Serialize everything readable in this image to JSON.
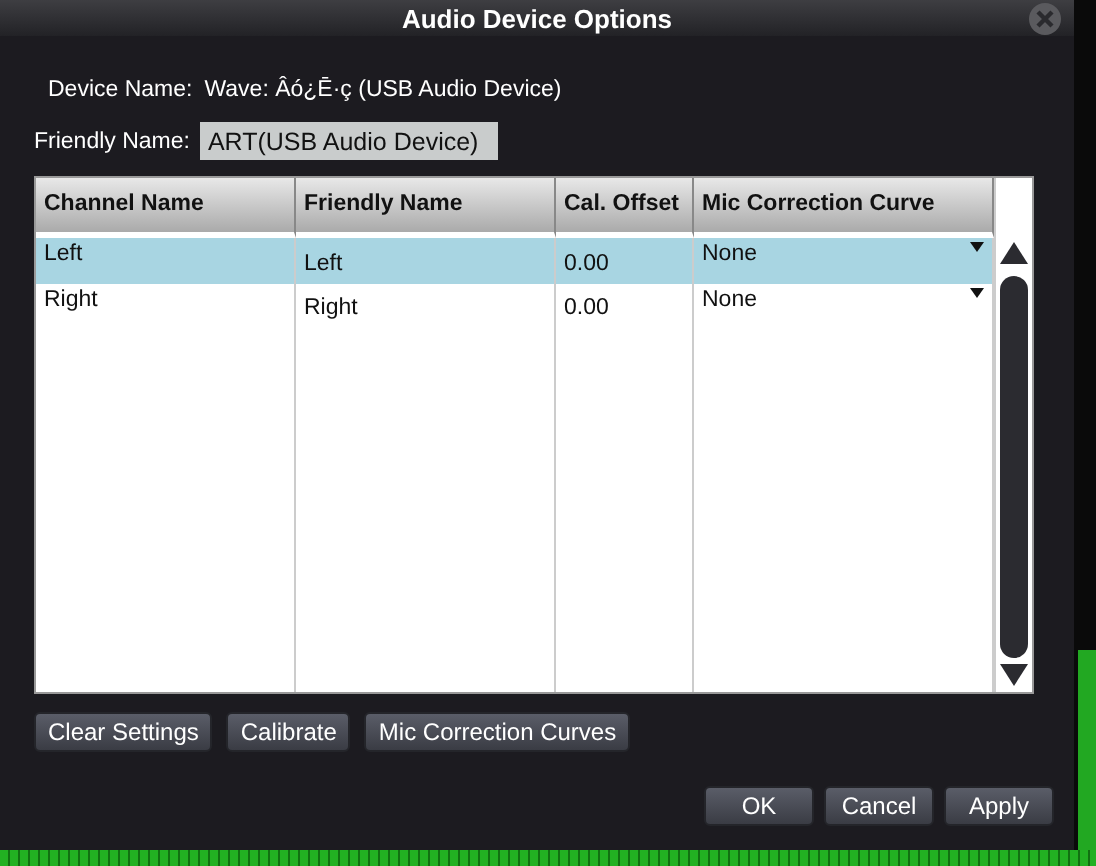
{
  "window": {
    "title": "Audio Device Options"
  },
  "device_name": {
    "label": "Device Name:",
    "value": "Wave: Âó¿Ē·ç (USB Audio Device)"
  },
  "friendly_name": {
    "label": "Friendly Name:",
    "value": "ART(USB Audio Device)"
  },
  "table": {
    "columns": [
      "Channel Name",
      "Friendly Name",
      "Cal. Offset",
      "Mic Correction Curve"
    ],
    "rows": [
      {
        "selected": true,
        "cells": [
          "Left",
          "Left",
          "0.00",
          "None"
        ]
      },
      {
        "selected": false,
        "cells": [
          "Right",
          "Right",
          "0.00",
          "None"
        ]
      }
    ]
  },
  "tool_buttons": [
    "Clear Settings",
    "Calibrate",
    "Mic Correction Curves"
  ],
  "dialog_buttons": [
    "OK",
    "Cancel",
    "Apply"
  ]
}
